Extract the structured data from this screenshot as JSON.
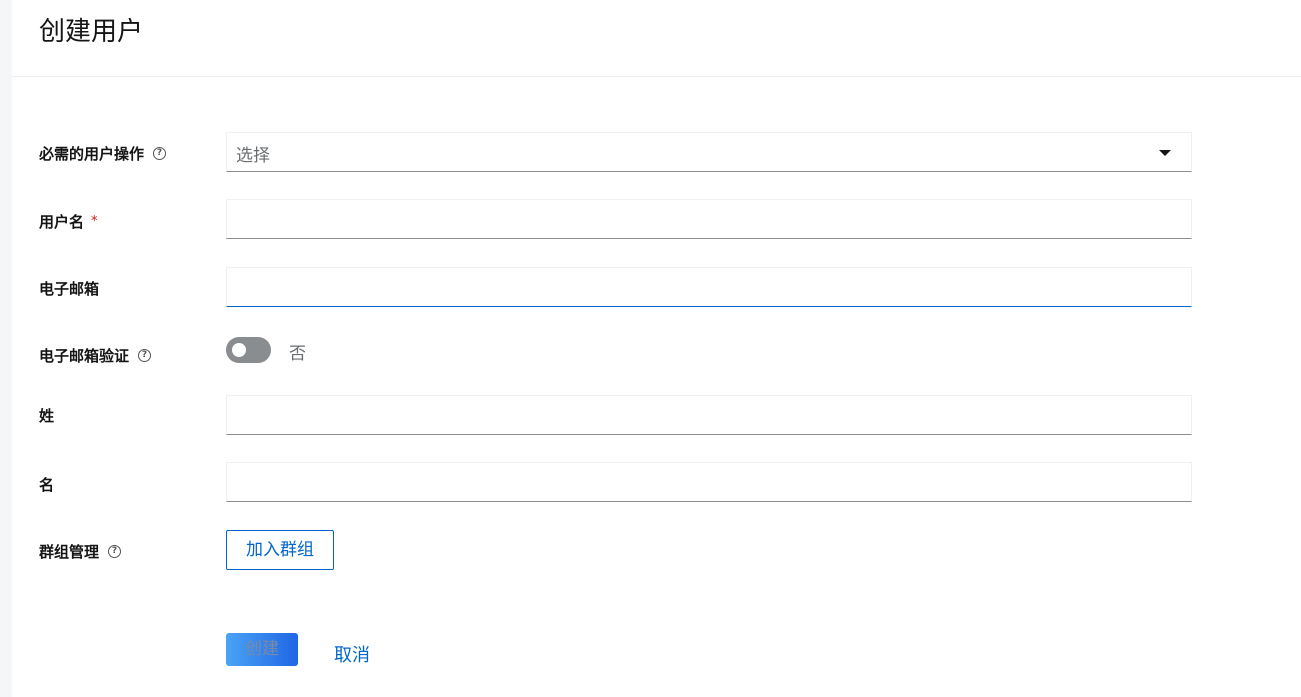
{
  "header": {
    "title": "创建用户"
  },
  "form": {
    "required_actions": {
      "label": "必需的用户操作",
      "placeholder": "选择"
    },
    "username": {
      "label": "用户名",
      "required_mark": "*",
      "value": ""
    },
    "email": {
      "label": "电子邮箱",
      "value": ""
    },
    "email_verified": {
      "label": "电子邮箱验证",
      "state_text": "否",
      "on": false
    },
    "last_name": {
      "label": "姓",
      "value": ""
    },
    "first_name": {
      "label": "名",
      "value": ""
    },
    "groups": {
      "label": "群组管理",
      "button_label": "加入群组"
    }
  },
  "help_icon_glyph": "?",
  "actions": {
    "create_label": "创建",
    "cancel_label": "取消"
  },
  "colors": {
    "accent": "#0066cc",
    "toggle_off": "#8a8d90",
    "required": "#c9190b"
  }
}
